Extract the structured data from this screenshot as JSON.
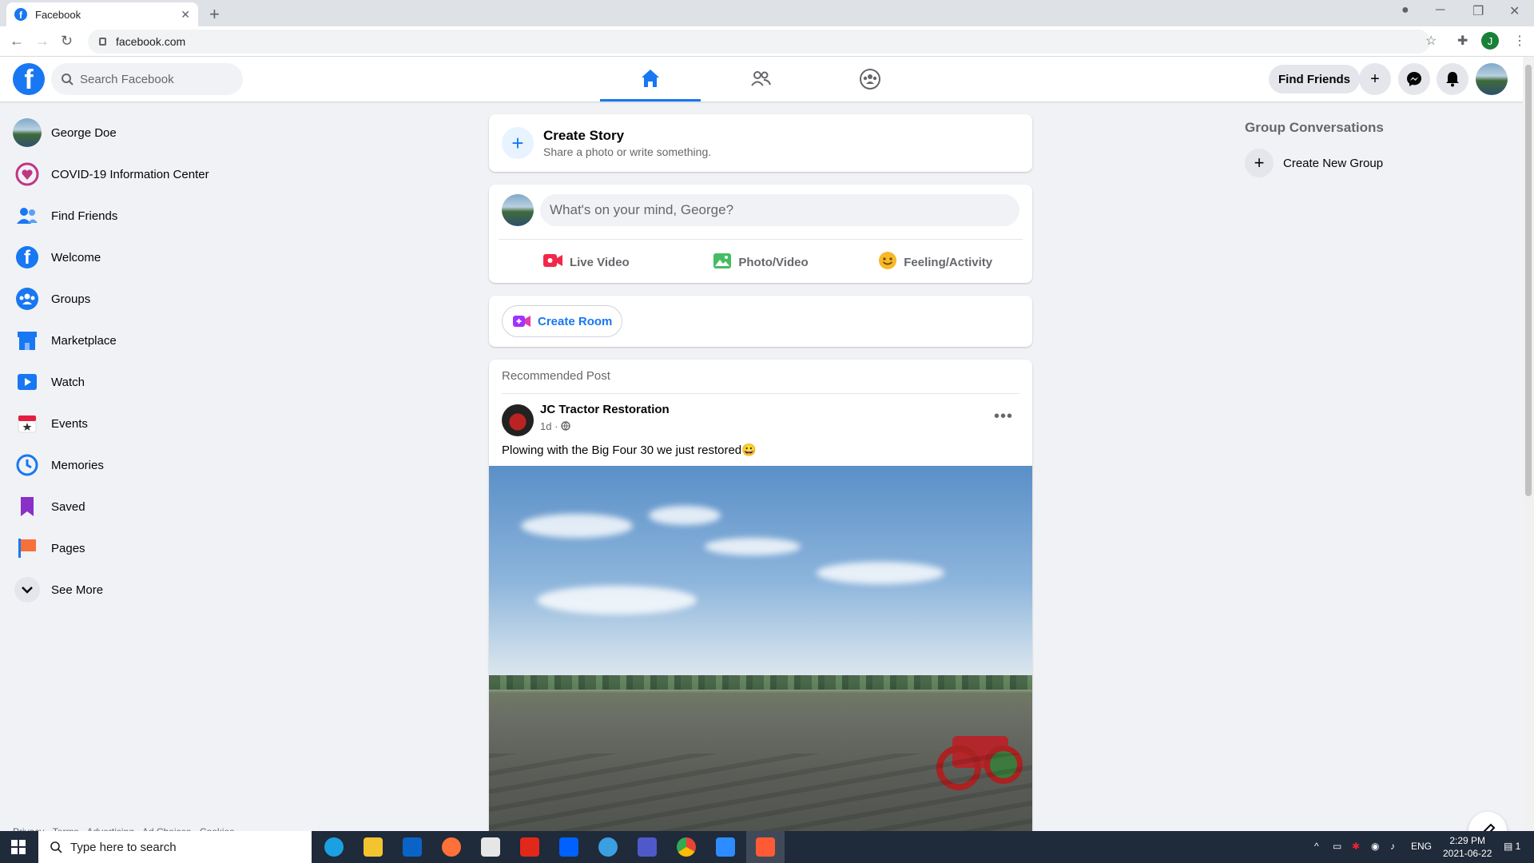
{
  "browser": {
    "tab_title": "Facebook",
    "tab_close": "✕",
    "new_tab": "+",
    "url": "facebook.com"
  },
  "fb_header": {
    "search_placeholder": "Search Facebook",
    "find_friends_label": "Find Friends",
    "create_label": "+"
  },
  "sidebar": {
    "user_name": "George Doe",
    "items": [
      {
        "label": "COVID-19 Information Center",
        "icon": "heart-icon",
        "color": "#c13584"
      },
      {
        "label": "Find Friends",
        "icon": "friends-icon",
        "color": "#1877f2"
      },
      {
        "label": "Welcome",
        "icon": "facebook-icon",
        "color": "#1877f2"
      },
      {
        "label": "Groups",
        "icon": "groups-icon",
        "color": "#1877f2"
      },
      {
        "label": "Marketplace",
        "icon": "store-icon",
        "color": "#1877f2"
      },
      {
        "label": "Watch",
        "icon": "watch-icon",
        "color": "#1877f2"
      },
      {
        "label": "Events",
        "icon": "calendar-icon",
        "color": "#e41e3f"
      },
      {
        "label": "Memories",
        "icon": "clock-icon",
        "color": "#1877f2"
      },
      {
        "label": "Saved",
        "icon": "bookmark-icon",
        "color": "#8b2fc9"
      },
      {
        "label": "Pages",
        "icon": "flag-icon",
        "color": "#f7703a"
      }
    ],
    "see_more": "See More",
    "footer": "Privacy · Terms · Advertising · Ad Choices · Cookies"
  },
  "story": {
    "title": "Create Story",
    "subtitle": "Share a photo or write something."
  },
  "composer": {
    "placeholder": "What's on your mind, George?",
    "actions": [
      {
        "label": "Live Video",
        "color": "#f02849"
      },
      {
        "label": "Photo/Video",
        "color": "#45bd62"
      },
      {
        "label": "Feeling/Activity",
        "color": "#f7b928"
      }
    ]
  },
  "room": {
    "label": "Create Room"
  },
  "post": {
    "section_label": "Recommended Post",
    "author": "JC Tractor Restoration",
    "meta": "1d ·",
    "text": "Plowing with the Big Four 30 we just restored😀",
    "more": "•••"
  },
  "right": {
    "group_title": "Group Conversations",
    "create_group": "Create New Group"
  },
  "taskbar": {
    "search_placeholder": "Type here to search",
    "lang": "ENG",
    "time": "2:29 PM",
    "date": "2021-06-22",
    "notif_count": "1"
  },
  "colors": {
    "brand": "#1877f2",
    "background": "#f0f2f5"
  }
}
